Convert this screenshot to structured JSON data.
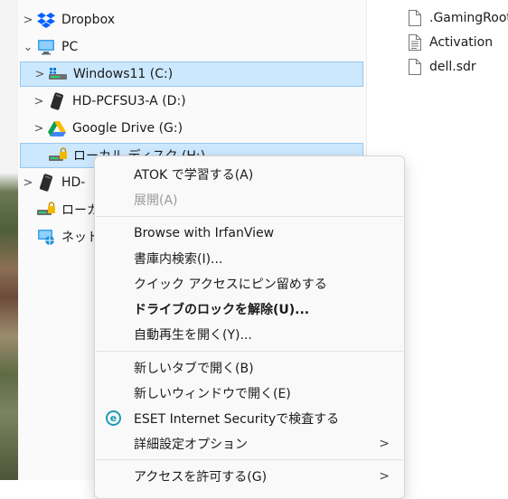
{
  "nav": {
    "items": [
      {
        "label": "Dropbox",
        "chevron": ">",
        "icon": "dropbox-icon"
      },
      {
        "label": "PC",
        "chevron": "v",
        "icon": "pc-icon"
      },
      {
        "label": "Windows11 (C:)",
        "chevron": ">",
        "icon": "system-drive-icon"
      },
      {
        "label": "HD-PCFSU3-A (D:)",
        "chevron": ">",
        "icon": "external-drive-icon"
      },
      {
        "label": "Google Drive (G:)",
        "chevron": ">",
        "icon": "google-drive-icon"
      },
      {
        "label": "ローカル ディスク (H:)",
        "chevron": "",
        "icon": "locked-drive-icon"
      },
      {
        "label": "HD-",
        "chevron": ">",
        "icon": "external-drive-icon"
      },
      {
        "label": "ローカ",
        "chevron": "",
        "icon": "locked-drive-icon"
      },
      {
        "label": "ネット",
        "chevron": "",
        "icon": "network-icon"
      }
    ]
  },
  "files": [
    {
      "name": ".GamingRoot",
      "icon": "file-icon"
    },
    {
      "name": "Activation",
      "icon": "text-file-icon"
    },
    {
      "name": "dell.sdr",
      "icon": "file-icon"
    }
  ],
  "context_menu": {
    "items": [
      {
        "label": "ATOK で学習する(A)",
        "disabled": false,
        "bold": false
      },
      {
        "label": "展開(A)",
        "disabled": true,
        "bold": false
      },
      {
        "label": "Browse with IrfanView",
        "disabled": false,
        "bold": false
      },
      {
        "label": "書庫内検索(I)...",
        "disabled": false,
        "bold": false
      },
      {
        "label": "クイック アクセスにピン留めする",
        "disabled": false,
        "bold": false
      },
      {
        "label": "ドライブのロックを解除(U)...",
        "disabled": false,
        "bold": true
      },
      {
        "label": "自動再生を開く(Y)...",
        "disabled": false,
        "bold": false
      },
      {
        "label": "新しいタブで開く(B)",
        "disabled": false,
        "bold": false
      },
      {
        "label": "新しいウィンドウで開く(E)",
        "disabled": false,
        "bold": false
      },
      {
        "label": "ESET Internet Securityで検査する",
        "disabled": false,
        "bold": false,
        "icon": "eset-icon"
      },
      {
        "label": "詳細設定オプション",
        "disabled": false,
        "bold": false,
        "submenu": ">"
      },
      {
        "label": "アクセスを許可する(G)",
        "disabled": false,
        "bold": false,
        "submenu": ">"
      }
    ]
  },
  "colors": {
    "selection": "#cce8ff",
    "selection_border": "#99c7ee",
    "accent": "#0067c0"
  }
}
